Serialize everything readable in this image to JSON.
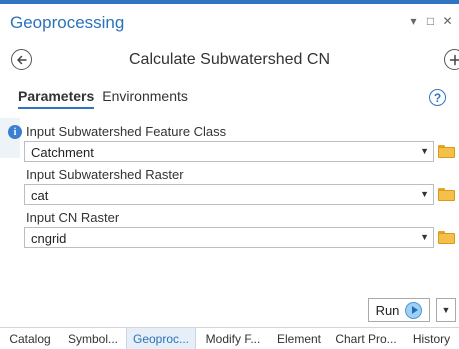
{
  "pane": {
    "title": "Geoprocessing",
    "controls": [
      "▾",
      "□",
      "✕"
    ]
  },
  "tool": {
    "title": "Calculate Subwatershed CN"
  },
  "tabs": [
    {
      "label": "Parameters",
      "active": true
    },
    {
      "label": "Environments",
      "active": false
    }
  ],
  "help_label": "?",
  "info_label": "i",
  "params": [
    {
      "label": "Input Subwatershed Feature Class",
      "value": "Catchment"
    },
    {
      "label": "Input Subwatershed Raster",
      "value": "cat"
    },
    {
      "label": "Input CN Raster",
      "value": "cngrid"
    }
  ],
  "run": {
    "label": "Run"
  },
  "bottom_tabs": [
    {
      "label": "Catalog",
      "active": false
    },
    {
      "label": "Symbol...",
      "active": false
    },
    {
      "label": "Geoproc...",
      "active": true
    },
    {
      "label": "Modify F...",
      "active": false
    },
    {
      "label": "Element",
      "active": false
    },
    {
      "label": "Chart Pro...",
      "active": false
    },
    {
      "label": "History",
      "active": false
    }
  ],
  "colors": {
    "accent": "#2b73b7",
    "folder": "#f4c04a",
    "run_icon": "#9fd0f2"
  }
}
